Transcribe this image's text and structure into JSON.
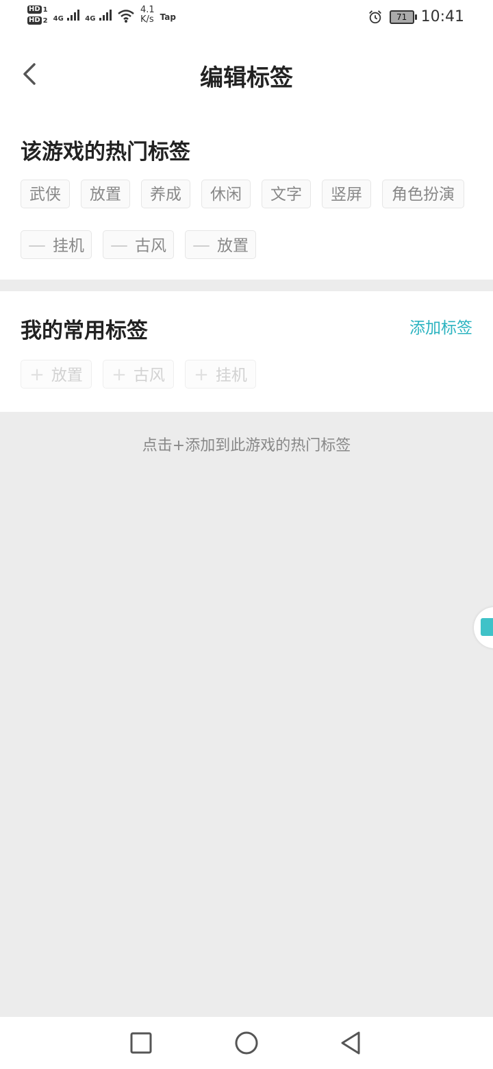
{
  "status_bar": {
    "hd1": "HD",
    "hd1_slot": "1",
    "hd2": "HD",
    "hd2_slot": "2",
    "sig1": "4G",
    "sig2": "4G",
    "net_speed_value": "4.1",
    "net_speed_unit": "K/s",
    "app_badge": "Tap",
    "battery": "71",
    "time": "10:41",
    "icons": [
      "hd-icon",
      "signal-icon",
      "wifi-icon",
      "alarm-icon",
      "battery-icon"
    ]
  },
  "header": {
    "title": "编辑标签",
    "back_icon": "chevron-left-icon"
  },
  "hot_tags": {
    "title": "该游戏的热门标签",
    "tags": [
      "武侠",
      "放置",
      "养成",
      "休闲",
      "文字",
      "竖屏",
      "角色扮演"
    ],
    "removable_tags": [
      "挂机",
      "古风",
      "放置"
    ],
    "remove_glyph": "—"
  },
  "common_tags": {
    "title": "我的常用标签",
    "add_link": "添加标签",
    "tags": [
      "放置",
      "古风",
      "挂机"
    ],
    "add_glyph": "+"
  },
  "hint": "点击+添加到此游戏的热门标签",
  "colors": {
    "accent": "#2bb3c0",
    "background": "#ececec",
    "tag_text": "#888888"
  },
  "nav": {
    "icons": [
      "recent-apps-icon",
      "home-icon",
      "back-triangle-icon"
    ]
  }
}
